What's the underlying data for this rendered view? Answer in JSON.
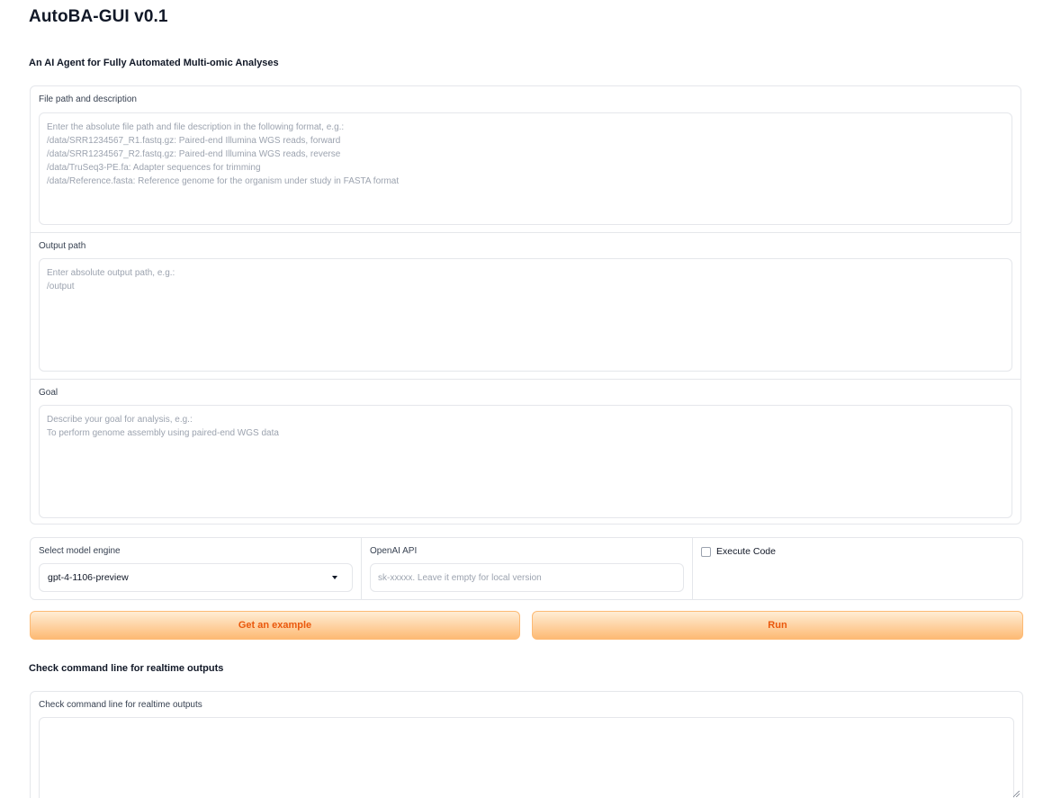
{
  "app": {
    "title": "AutoBA-GUI v0.1",
    "subtitle": "An AI Agent for Fully Automated Multi-omic Analyses"
  },
  "form": {
    "file_path": {
      "label": "File path and description",
      "value": "",
      "placeholder": "Enter the absolute file path and file description in the following format, e.g.:\n/data/SRR1234567_R1.fastq.gz: Paired-end Illumina WGS reads, forward\n/data/SRR1234567_R2.fastq.gz: Paired-end Illumina WGS reads, reverse\n/data/TruSeq3-PE.fa: Adapter sequences for trimming\n/data/Reference.fasta: Reference genome for the organism under study in FASTA format"
    },
    "output_path": {
      "label": "Output path",
      "value": "",
      "placeholder": "Enter absolute output path, e.g.:\n/output"
    },
    "goal": {
      "label": "Goal",
      "value": "",
      "placeholder": "Describe your goal for analysis, e.g.:\nTo perform genome assembly using paired-end WGS data"
    }
  },
  "settings": {
    "model_engine": {
      "label": "Select model engine",
      "selected": "gpt-4-1106-preview"
    },
    "openai_api": {
      "label": "OpenAI API",
      "value": "",
      "placeholder": "sk-xxxxx. Leave it empty for local version"
    },
    "execute_code": {
      "label": "Execute Code",
      "checked": false
    }
  },
  "actions": {
    "example_label": "Get an example",
    "run_label": "Run"
  },
  "output": {
    "heading": "Check command line for realtime outputs",
    "label": "Check command line for realtime outputs",
    "value": ""
  },
  "colors": {
    "accent_text": "#ea580c",
    "button_gradient_top": "#ffedd5",
    "button_gradient_bottom": "#fdba74",
    "border": "#e5e7eb",
    "placeholder": "#9ca3af"
  },
  "icons": {
    "dropdown": "chevron-down-icon",
    "resize": "resize-handle-icon"
  }
}
